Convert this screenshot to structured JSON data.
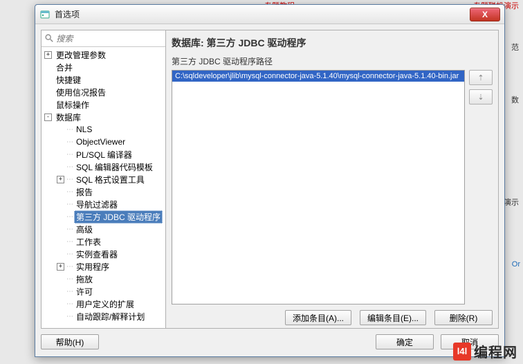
{
  "window": {
    "title": "首选项",
    "close_icon": "X"
  },
  "search": {
    "placeholder": "搜索"
  },
  "tree": [
    {
      "d": 1,
      "exp": "+",
      "label": "更改管理参数"
    },
    {
      "d": 1,
      "exp": "",
      "label": "合并"
    },
    {
      "d": 1,
      "exp": "",
      "label": "快捷键"
    },
    {
      "d": 1,
      "exp": "",
      "label": "使用信况报告"
    },
    {
      "d": 1,
      "exp": "",
      "label": "鼠标操作"
    },
    {
      "d": 1,
      "exp": "-",
      "label": "数据库"
    },
    {
      "d": 2,
      "exp": "",
      "label": "NLS"
    },
    {
      "d": 2,
      "exp": "",
      "label": "ObjectViewer"
    },
    {
      "d": 2,
      "exp": "",
      "label": "PL/SQL 编译器"
    },
    {
      "d": 2,
      "exp": "",
      "label": "SQL 编辑器代码模板"
    },
    {
      "d": 2,
      "exp": "+",
      "label": "SQL 格式设置工具"
    },
    {
      "d": 2,
      "exp": "",
      "label": "报告"
    },
    {
      "d": 2,
      "exp": "",
      "label": "导航过滤器"
    },
    {
      "d": 2,
      "exp": "",
      "label": "第三方 JDBC 驱动程序",
      "selected": true
    },
    {
      "d": 2,
      "exp": "",
      "label": "高级"
    },
    {
      "d": 2,
      "exp": "",
      "label": "工作表"
    },
    {
      "d": 2,
      "exp": "",
      "label": "实例查看器"
    },
    {
      "d": 2,
      "exp": "+",
      "label": "实用程序"
    },
    {
      "d": 2,
      "exp": "",
      "label": "拖放"
    },
    {
      "d": 2,
      "exp": "",
      "label": "许可"
    },
    {
      "d": 2,
      "exp": "",
      "label": "用户定义的扩展"
    },
    {
      "d": 2,
      "exp": "",
      "label": "自动跟踪/解释计划"
    }
  ],
  "right": {
    "title": "数据库: 第三方 JDBC 驱动程序",
    "subtitle": "第三方 JDBC 驱动程序路径",
    "items": [
      "C:\\sqldeveloper\\jlib\\mysql-connector-java-5.1.40\\mysql-connector-java-5.1.40-bin.jar"
    ],
    "move_up": "⇡",
    "move_down": "⇣",
    "add": "添加条目(A)...",
    "edit": "编辑条目(E)...",
    "delete": "删除(R)"
  },
  "footer": {
    "help": "帮助(H)",
    "ok": "确定",
    "cancel": "取消"
  },
  "logo": {
    "mark": "l4l",
    "text": "编程网"
  },
  "bg": {
    "f1": "专题教程",
    "f2": "专题联机演示",
    "f3": "范",
    "f4": "数",
    "f5": "Or",
    "f6": "机演示"
  }
}
